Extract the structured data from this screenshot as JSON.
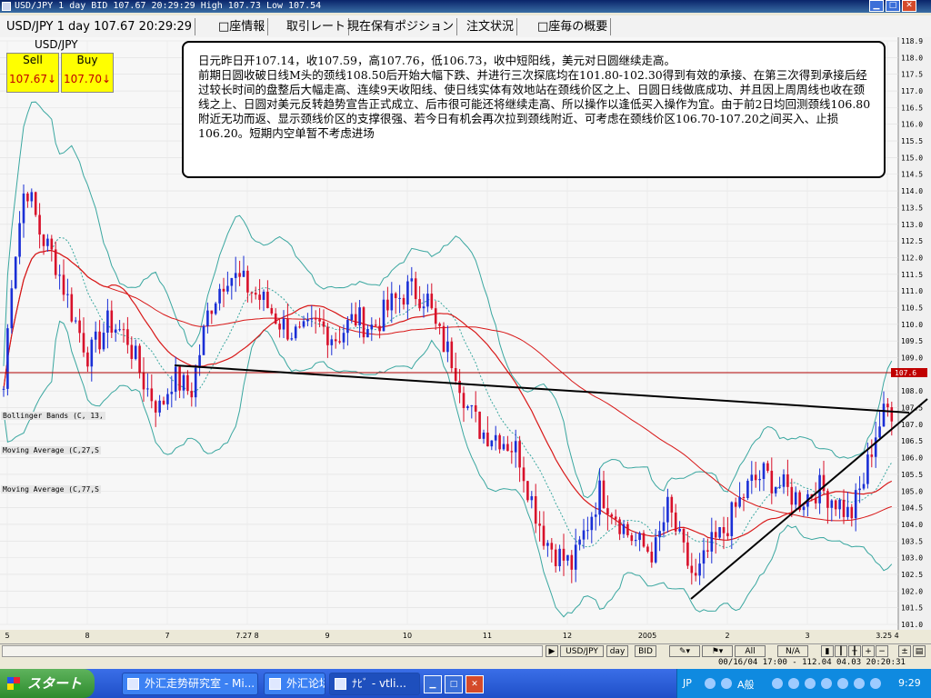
{
  "window": {
    "title": "USD/JPY 1 day BID 107.67 20:29:29 High 107.73 Low 107.54"
  },
  "tabs": [
    {
      "label": "USD/JPY 1 day 107.67 20:29:29"
    },
    {
      "label": "□座情報"
    },
    {
      "label": "取引レート"
    },
    {
      "label": "現在保有ポジション"
    },
    {
      "label": "注文状況"
    },
    {
      "label": "□座毎の概要"
    }
  ],
  "ticker": {
    "symbol": "USD/JPY"
  },
  "quote": {
    "sell_label": "Sell",
    "sell_value": "107.67↓",
    "buy_label": "Buy",
    "buy_value": "107.70↓"
  },
  "note": {
    "text": "日元昨日开107.14，收107.59，高107.76，低106.73，收中短阳线，美元对日圆继续走高。\n前期日圆收破日线M头的颈线108.50后开始大幅下跌、并进行三次探底均在101.80-102.30得到有效的承接、在第三次得到承接后经过较长时间的盘整后大幅走高、连续9天收阳线、使日线实体有效地站在颈线价区之上、日圆日线做底成功、并且因上周周线也收在颈线之上、日圆对美元反转趋势宣告正式成立、后市很可能还将继续走高、所以操作以逢低买入操作为宜。由于前2日均回测颈线106.80附近无功而返、显示颈线价区的支撑很强、若今日有机会再次拉到颈线附近、可考虑在颈线价区106.70-107.20之间买入、止损106.20。短期内空单暂不考虑进场"
  },
  "indicators": [
    {
      "label": "Bollinger Bands (C, 13,"
    },
    {
      "label": "Moving Average (C,27,S"
    },
    {
      "label": "Moving Average (C,77,S"
    }
  ],
  "chart_data": {
    "type": "candlestick",
    "symbol": "USD/JPY",
    "interval": "1 day",
    "ylim": [
      101.0,
      118.9
    ],
    "y_ticks": [
      "118.9",
      "118.0",
      "117.5",
      "117.0",
      "116.5",
      "116.0",
      "115.5",
      "115.0",
      "114.5",
      "114.0",
      "113.5",
      "113.0",
      "112.5",
      "112.0",
      "111.5",
      "111.0",
      "110.5",
      "110.0",
      "109.5",
      "109.0",
      "108.5",
      "108.0",
      "107.5",
      "107.0",
      "106.5",
      "106.0",
      "105.5",
      "105.0",
      "104.5",
      "104.0",
      "103.5",
      "103.0",
      "102.5",
      "102.0",
      "101.5",
      "101.0"
    ],
    "x_ticks": [
      "5",
      "8",
      "7",
      "7.27 8",
      "9",
      "10",
      "11",
      "12",
      "2005",
      "2",
      "3",
      "3.25 4"
    ],
    "current_price": "107.6",
    "colors": {
      "up": "#1a2fd6",
      "down": "#d8102a",
      "ma_short": "#d81818",
      "ma_long": "#d81818",
      "bollinger": "#3aa7a0",
      "trendline": "#000000",
      "price_line": "#b00000"
    },
    "grid": true
  },
  "bottombar": {
    "symbol": "USD/JPY",
    "interval": "day",
    "side": "BID",
    "all": "All",
    "na": "N/A"
  },
  "statusline": {
    "text": "00/16/04 17:00 - 112.04 04.03 20:20:31"
  },
  "taskbar": {
    "start": "スタート",
    "items": [
      {
        "label": "外汇走势研究室 - Mi..."
      },
      {
        "label": "外汇论坛"
      },
      {
        "label": "ﾅﾋﾞ - vtli..."
      }
    ],
    "lang": "JP",
    "tray_label": "A般",
    "clock": "9:29"
  }
}
